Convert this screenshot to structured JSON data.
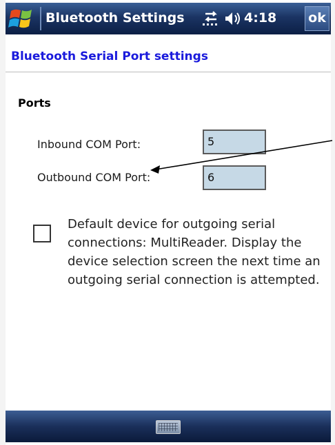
{
  "titlebar": {
    "app_title": "Bluetooth Settings",
    "clock": "4:18",
    "ok_label": "ok",
    "start_icon": "windows-flag-icon",
    "connectivity_icon": "connectivity-icon",
    "volume_icon": "volume-icon"
  },
  "page": {
    "header": "Bluetooth Serial Port settings",
    "header_color": "#1a1adc"
  },
  "ports": {
    "section_title": "Ports",
    "inbound_label": "Inbound COM Port:",
    "inbound_value": "5",
    "outbound_label": "Outbound COM Port:",
    "outbound_value": "6"
  },
  "default_device": {
    "checked": false,
    "text": "Default device for outgoing serial connections: MultiReader. Display the device selection screen the next time an outgoing serial connection is attempted."
  },
  "menubar": {
    "keyboard_icon": "keyboard-icon"
  },
  "colors": {
    "bar_dark": "#1b3463",
    "field_fill": "#c6d9e6"
  }
}
